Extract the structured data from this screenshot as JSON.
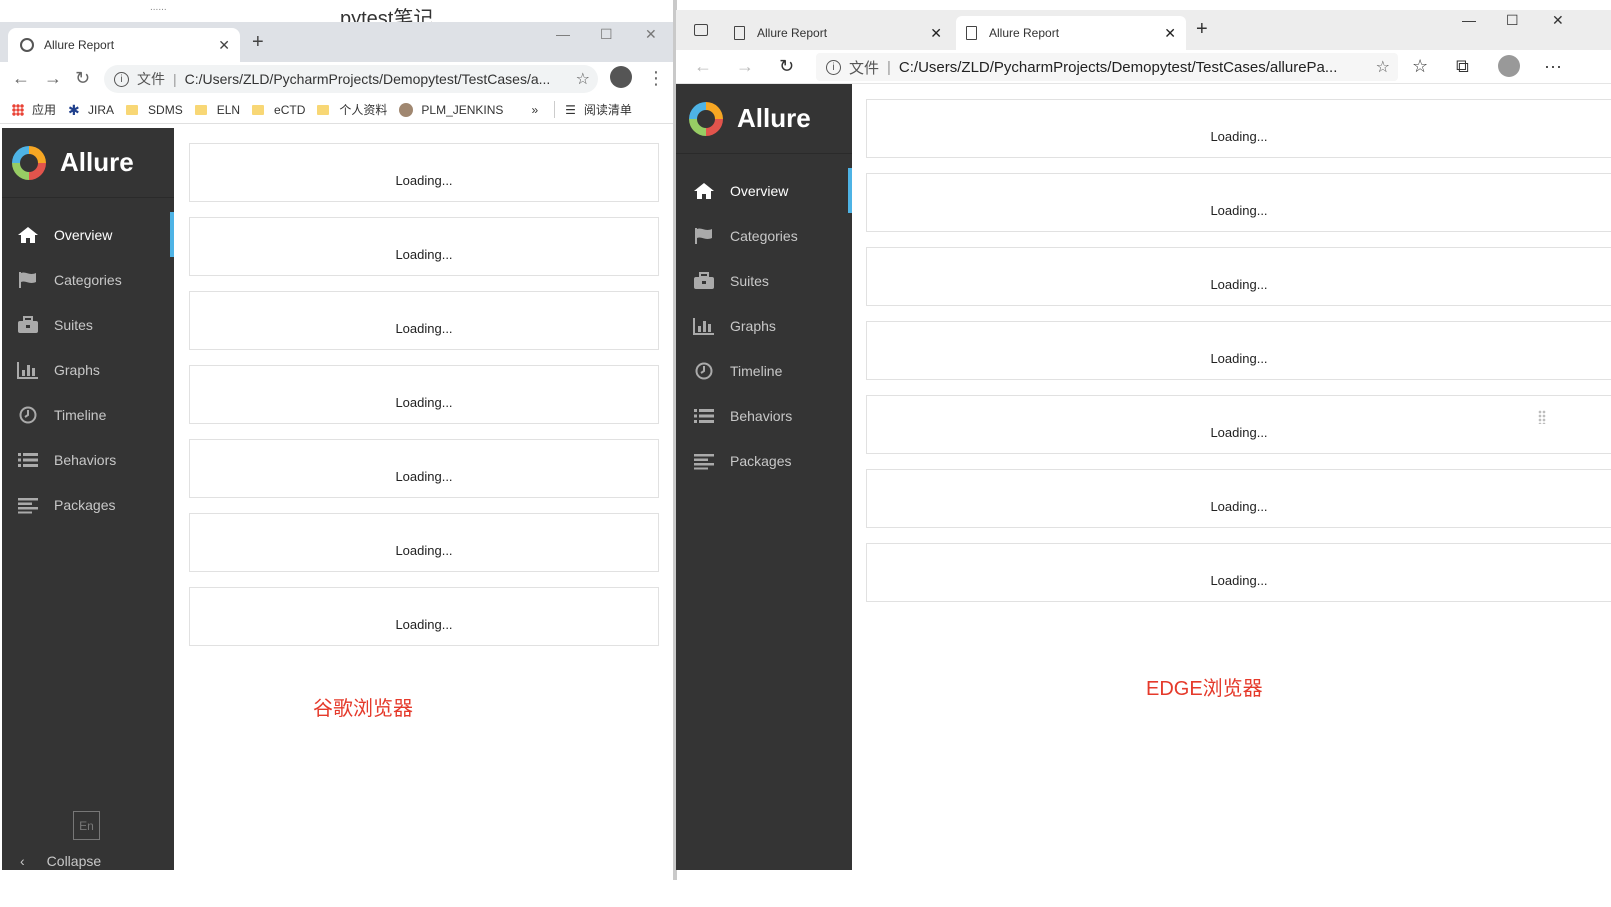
{
  "chrome": {
    "top_partial_text": "pytest笔记",
    "top_partial_small": "......",
    "tab_title": "Allure Report",
    "new_tab_label": "+",
    "window_controls": {
      "minimize": "—",
      "maximize": "☐",
      "close": "✕"
    },
    "address": {
      "security_label": "文件",
      "url": "C:/Users/ZLD/PycharmProjects/Demopytest/TestCases/a..."
    },
    "bookmarks": [
      {
        "label": "应用",
        "icon": "apps-icon"
      },
      {
        "label": "JIRA",
        "icon": "jira-icon"
      },
      {
        "label": "SDMS",
        "icon": "folder-icon"
      },
      {
        "label": "ELN",
        "icon": "folder-icon"
      },
      {
        "label": "eCTD",
        "icon": "folder-icon"
      },
      {
        "label": "个人资料",
        "icon": "folder-icon"
      },
      {
        "label": "PLM_JENKINS",
        "icon": "avatar-icon"
      }
    ],
    "bookmarks_more": "»",
    "reading_list": "阅读清单",
    "caption": "谷歌浏览器"
  },
  "edge": {
    "tabs": [
      {
        "title": "Allure Report"
      },
      {
        "title": "Allure Report"
      }
    ],
    "new_tab_label": "+",
    "window_controls": {
      "minimize": "—",
      "maximize": "☐",
      "close": "✕"
    },
    "address": {
      "security_label": "文件",
      "url": "C:/Users/ZLD/PycharmProjects/Demopytest/TestCases/allurePa..."
    },
    "more_label": "···",
    "caption": "EDGE浏览器"
  },
  "allure": {
    "brand": "Allure",
    "nav": [
      {
        "label": "Overview",
        "icon": "home-icon"
      },
      {
        "label": "Categories",
        "icon": "flag-icon"
      },
      {
        "label": "Suites",
        "icon": "briefcase-icon"
      },
      {
        "label": "Graphs",
        "icon": "bar-chart-icon"
      },
      {
        "label": "Timeline",
        "icon": "clock-icon"
      },
      {
        "label": "Behaviors",
        "icon": "list-icon"
      },
      {
        "label": "Packages",
        "icon": "align-left-icon"
      }
    ],
    "loading_text": "Loading...",
    "language_button": "En",
    "collapse_label": "Collapse"
  },
  "colors": {
    "sidebar_bg": "#343434",
    "active_indicator": "#4eb3e5",
    "caption_red": "#e53a2b"
  }
}
